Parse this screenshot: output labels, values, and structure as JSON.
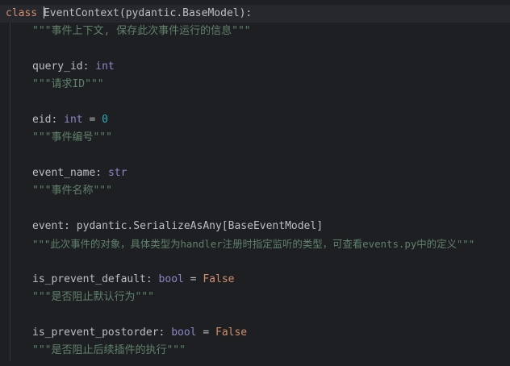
{
  "code": {
    "class_line": {
      "keyword": "class",
      "class_name": "EventContext",
      "base": "(pydantic.BaseModel):"
    },
    "class_doc": "\"\"\"事件上下文, 保存此次事件运行的信息\"\"\"",
    "fields": [
      {
        "name": "query_id",
        "colon": ": ",
        "type": "int",
        "default_op": "",
        "default": "",
        "doc": "\"\"\"请求ID\"\"\""
      },
      {
        "name": "eid",
        "colon": ": ",
        "type": "int",
        "default_op": " = ",
        "default": "0",
        "doc": "\"\"\"事件编号\"\"\""
      },
      {
        "name": "event_name",
        "colon": ": ",
        "type": "str",
        "default_op": "",
        "default": "",
        "doc": "\"\"\"事件名称\"\"\""
      },
      {
        "name": "event",
        "colon": ": ",
        "type": "pydantic.SerializeAsAny[BaseEventModel]",
        "default_op": "",
        "default": "",
        "doc": "\"\"\"此次事件的对象，具体类型为handler注册时指定监听的类型，可查看events.py中的定义\"\"\""
      },
      {
        "name": "is_prevent_default",
        "colon": ": ",
        "type": "bool",
        "default_op": " = ",
        "default": "False",
        "doc": "\"\"\"是否阻止默认行为\"\"\""
      },
      {
        "name": "is_prevent_postorder",
        "colon": ": ",
        "type": "bool",
        "default_op": " = ",
        "default": "False",
        "doc": "\"\"\"是否阻止后续插件的执行\"\"\""
      }
    ]
  },
  "colors": {
    "background": "#1e1f22",
    "keyword": "#cf8e6d",
    "builtin_type": "#8888c6",
    "number": "#2aacb8",
    "docstring": "#5f826b",
    "text": "#bcbec4"
  }
}
